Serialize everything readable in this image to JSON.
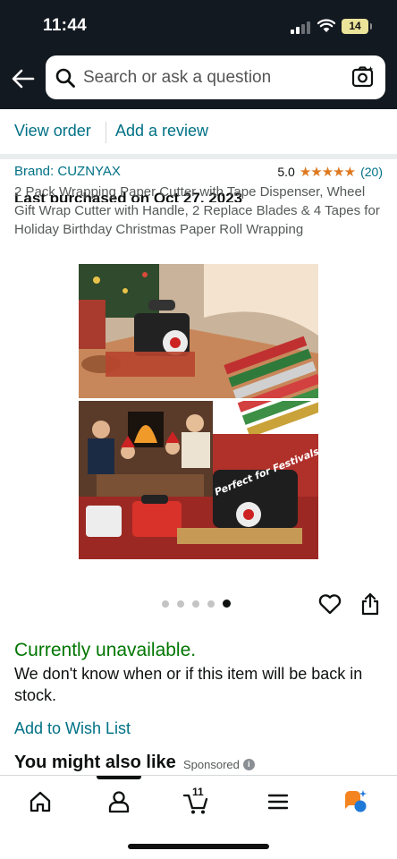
{
  "status_bar": {
    "time": "11:44",
    "battery": "14"
  },
  "header": {
    "search_placeholder": "Search or ask a question"
  },
  "order": {
    "last_purchased": "Last purchased on Oct 27, 2023",
    "view_order": "View order",
    "add_review": "Add a review"
  },
  "product": {
    "brand": "Brand: CUZNYAX",
    "rating": "5.0",
    "stars": "★★★★★",
    "review_count": "(20)",
    "title": "2 Pack Wrapping Paper Cutter with Tape Dispenser, Wheel Gift Wrap Cutter with Handle, 2 Replace Blades & 4 Tapes for Holiday Birthday Christmas Paper Roll Wrapping",
    "image_overlay_text": "Perfect for Festivals",
    "image_count": 5,
    "active_image_index": 4
  },
  "availability": {
    "status": "Currently unavailable.",
    "message": "We don't know when or if this item will be back in stock."
  },
  "wish_list": "Add to Wish List",
  "recommendations": {
    "heading": "You might also like",
    "sponsored": "Sponsored",
    "info_glyph": "i"
  },
  "bottom_nav": {
    "items": [
      "home-icon",
      "account-icon",
      "cart-icon",
      "menu-icon",
      "rufus-icon"
    ],
    "cart_count": "11"
  },
  "colors": {
    "header_bg": "#131921",
    "link": "#007185",
    "available_green": "#007600",
    "star_orange": "#de7921"
  }
}
